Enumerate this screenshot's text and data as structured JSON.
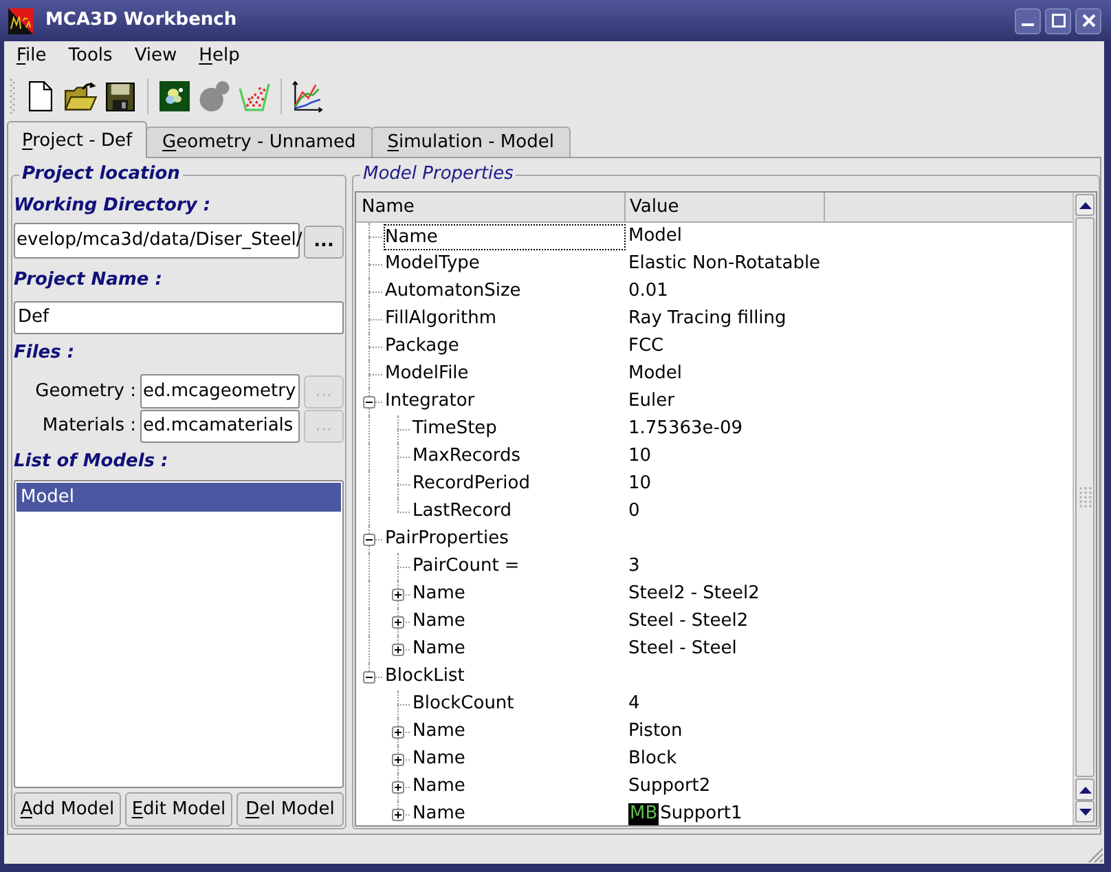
{
  "window": {
    "title": "MCA3D Workbench"
  },
  "menu": [
    {
      "label": "File",
      "mnemonic": true
    },
    {
      "label": "Tools",
      "mnemonic": false
    },
    {
      "label": "View",
      "mnemonic": false
    },
    {
      "label": "Help",
      "mnemonic": true
    }
  ],
  "toolbar": [
    {
      "kind": "document",
      "disabled": false
    },
    {
      "kind": "folder",
      "disabled": false
    },
    {
      "kind": "floppy",
      "disabled": false
    },
    {
      "kind": "separator"
    },
    {
      "kind": "tile",
      "disabled": false
    },
    {
      "kind": "blobs",
      "disabled": true
    },
    {
      "kind": "dot-cup",
      "disabled": false
    },
    {
      "kind": "separator"
    },
    {
      "kind": "line-chart",
      "disabled": false
    }
  ],
  "tabs": [
    {
      "label": "Project - Def",
      "mnemonic": true,
      "selected": true
    },
    {
      "label": "Geometry - Unnamed",
      "mnemonic": true,
      "selected": false
    },
    {
      "label": "Simulation - Model",
      "mnemonic": true,
      "selected": false
    }
  ],
  "project": {
    "title": "Project location",
    "working_directory": {
      "label": "Working Directory :",
      "value": "evelop/mca3d/data/Diser_Steel/",
      "button": {
        "label": "...",
        "disabled": false
      }
    },
    "project_name": {
      "label": "Project Name :",
      "value": "Def"
    },
    "files": {
      "label": "Files :",
      "rows": [
        {
          "label": "Geometry :",
          "value": "ed.mcageometry",
          "button": {
            "label": "...",
            "disabled": true
          }
        },
        {
          "label": "Materials :",
          "value": "ed.mcamaterials",
          "button": {
            "label": "...",
            "disabled": true
          }
        }
      ]
    },
    "models": {
      "label": "List of Models :",
      "items": [
        {
          "label": "Model",
          "selected": true
        }
      ]
    },
    "buttons": [
      {
        "label": "Add Model",
        "mnemonic": true
      },
      {
        "label": "Edit Model",
        "mnemonic": true
      },
      {
        "label": "Del Model",
        "mnemonic": true
      }
    ]
  },
  "model_properties": {
    "title": "Model Properties",
    "columns": [
      "Name",
      "Value"
    ],
    "rows": [
      {
        "name": "Name",
        "value": "Model",
        "focused": true
      },
      {
        "name": "ModelType",
        "value": "Elastic Non-Rotatable",
        "focused": false
      },
      {
        "name": "AutomatonSize",
        "value": "0.01",
        "focused": false
      },
      {
        "name": "FillAlgorithm",
        "value": "Ray Tracing filling",
        "focused": false
      },
      {
        "name": "Package",
        "value": "FCC",
        "focused": false
      },
      {
        "name": "ModelFile",
        "value": "Model",
        "focused": false
      },
      {
        "name": "Integrator",
        "value": "Euler",
        "focused": false,
        "expanded": true,
        "children": [
          {
            "name": "TimeStep",
            "value": "1.75363e-09",
            "focused": false
          },
          {
            "name": "MaxRecords",
            "value": "10",
            "focused": false
          },
          {
            "name": "RecordPeriod",
            "value": "10",
            "focused": false
          },
          {
            "name": "LastRecord",
            "value": "0",
            "focused": false
          }
        ]
      },
      {
        "name": "PairProperties",
        "focused": false,
        "expanded": true,
        "children": [
          {
            "name": "PairCount =",
            "value": "3",
            "focused": false
          },
          {
            "name": "Name",
            "value": "Steel2 - Steel2",
            "focused": false,
            "expanded": false
          },
          {
            "name": "Name",
            "value": "Steel - Steel2",
            "focused": false,
            "expanded": false
          },
          {
            "name": "Name",
            "value": "Steel - Steel",
            "focused": false,
            "expanded": false
          }
        ]
      },
      {
        "name": "BlockList",
        "focused": false,
        "expanded": true,
        "children": [
          {
            "name": "BlockCount",
            "value": "4",
            "focused": false
          },
          {
            "name": "Name",
            "value": "Piston",
            "focused": false,
            "expanded": false
          },
          {
            "name": "Name",
            "value": "Block",
            "focused": false,
            "expanded": false
          },
          {
            "name": "Name",
            "value": "Support2",
            "focused": false,
            "expanded": false
          },
          {
            "name": "Name",
            "value": "Support1",
            "badge": "MB",
            "focused": false,
            "expanded": false
          }
        ]
      }
    ]
  }
}
